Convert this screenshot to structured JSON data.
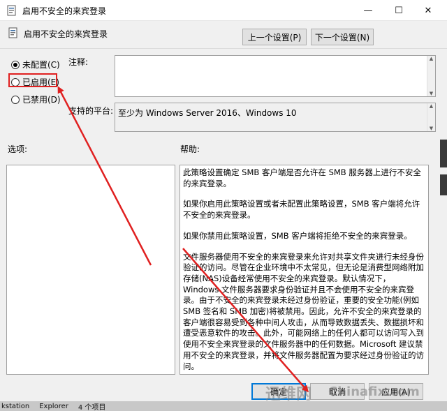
{
  "window": {
    "title": "启用不安全的来宾登录",
    "minimize_glyph": "—",
    "maximize_glyph": "☐",
    "close_glyph": "✕"
  },
  "header": {
    "policy_name": "启用不安全的来宾登录",
    "prev_button": "上一个设置(P)",
    "next_button": "下一个设置(N)"
  },
  "state": {
    "options": [
      {
        "label": "未配置(C)",
        "checked": true
      },
      {
        "label": "已启用(E)",
        "checked": false
      },
      {
        "label": "已禁用(D)",
        "checked": false
      }
    ]
  },
  "comment": {
    "label": "注释:",
    "value": ""
  },
  "supported": {
    "label": "支持的平台:",
    "value": "至少为 Windows Server 2016、Windows 10"
  },
  "options_panel": {
    "label": "选项:"
  },
  "help": {
    "label": "帮助:",
    "paragraphs": [
      "此策略设置确定 SMB 客户端是否允许在 SMB 服务器上进行不安全的来宾登录。",
      "如果你启用此策略设置或者未配置此策略设置，SMB 客户端将允许不安全的来宾登录。",
      "如果你禁用此策略设置，SMB 客户端将拒绝不安全的来宾登录。",
      "文件服务器使用不安全的来宾登录来允许对共享文件夹进行未经身份验证的访问。尽管在企业环境中不太常见，但无论是消费型网络附加存储(NAS)设备经常使用不安全的来宾登录。默认情况下，Windows 文件服务器要求身份验证并且不会使用不安全的来宾登录。由于不安全的来宾登录未经过身份验证，重要的安全功能(例如 SMB 签名和 SMB 加密)将被禁用。因此，允许不安全的来宾登录的客户端很容易受到各种中间人攻击，从而导致数据丢失、数据损坏和遭受恶意软件的攻击。此外，可能网络上的任何人都可以访问写入到使用不安全来宾登录的文件服务器中的任何数据。Microsoft 建议禁用不安全的来宾登录，并将文件服务器配置为要求经过身份验证的访问。"
    ]
  },
  "footer": {
    "ok_button": "确定",
    "cancel_button": "取消",
    "apply_button": "应用(A)"
  },
  "taskbar": {
    "items": [
      "kstation",
      "Explorer",
      "4 个项目"
    ]
  },
  "watermark": {
    "text_cn": "迅维网",
    "text_en": "Chinafix.com"
  },
  "colors": {
    "annotation": "#e02020",
    "focus": "#0078d7"
  }
}
